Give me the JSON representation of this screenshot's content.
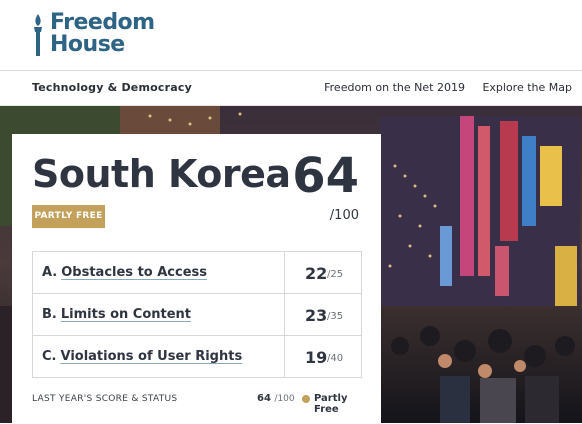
{
  "brand": {
    "line1": "Freedom",
    "line2": "House"
  },
  "subnav": {
    "section": "Technology & Democracy",
    "links": [
      "Freedom on the Net 2019",
      "Explore the Map"
    ]
  },
  "country": {
    "name": "South Korea",
    "score": "64",
    "score_max": "/100",
    "status": "PARTLY FREE",
    "categories": [
      {
        "letter": "A.",
        "label": "Obstacles to Access",
        "score": "22",
        "max": "/25"
      },
      {
        "letter": "B.",
        "label": "Limits on Content",
        "score": "23",
        "max": "/35"
      },
      {
        "letter": "C.",
        "label": "Violations of User Rights",
        "score": "19",
        "max": "/40"
      }
    ],
    "last_year": {
      "label": "LAST YEAR'S SCORE & STATUS",
      "score": "64",
      "max": "/100",
      "status": "Partly Free"
    }
  },
  "colors": {
    "brand_blue": "#2d6385",
    "status_gold": "#c3a15b"
  }
}
